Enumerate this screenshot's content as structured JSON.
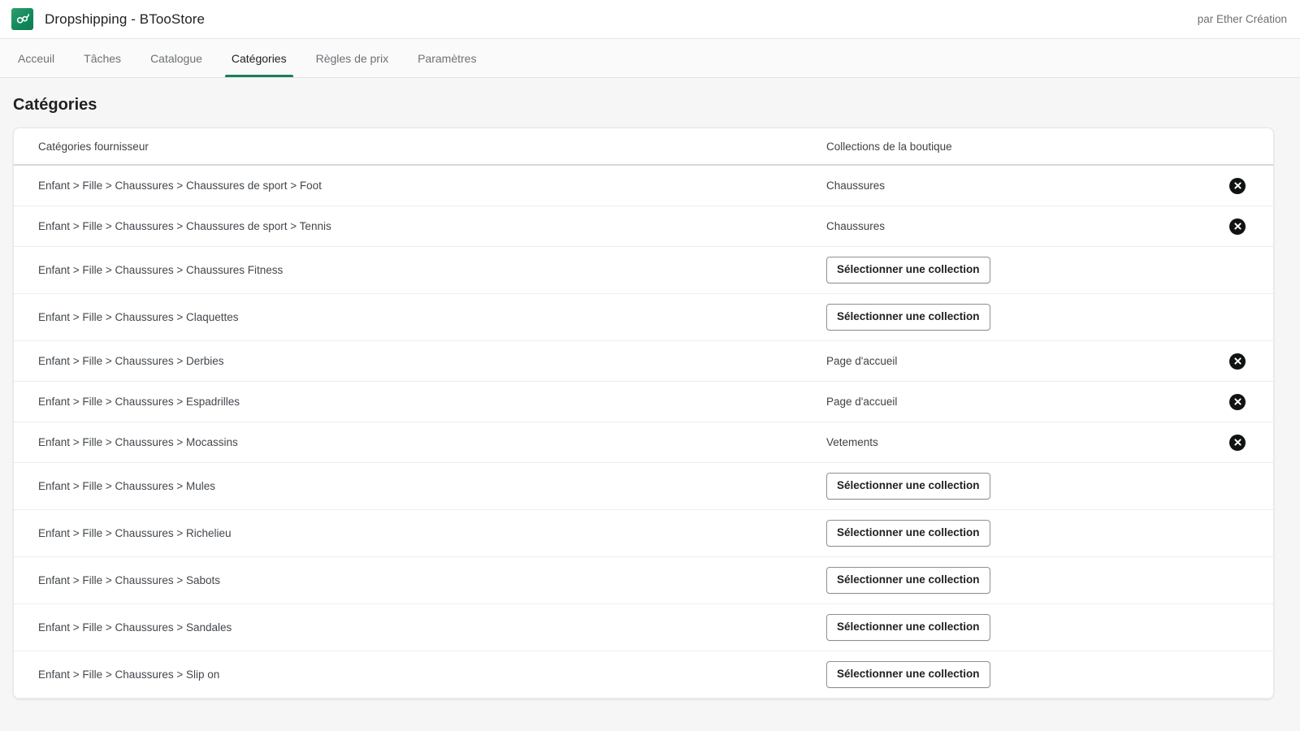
{
  "theme": {
    "accent": "#17805a",
    "logo_green": "#128a5d",
    "text_primary": "#202223",
    "text_secondary": "#6d7175",
    "page_bg": "#f6f6f7",
    "remove_btn_bg": "#111213"
  },
  "appbar": {
    "logo_icon": "infinity-chain-icon",
    "title": "Dropshipping - BTooStore",
    "author": "par Ether Création"
  },
  "nav": {
    "items": [
      {
        "label": "Acceuil",
        "active": false
      },
      {
        "label": "Tâches",
        "active": false
      },
      {
        "label": "Catalogue",
        "active": false
      },
      {
        "label": "Catégories",
        "active": true
      },
      {
        "label": "Règles de prix",
        "active": false
      },
      {
        "label": "Paramètres",
        "active": false
      }
    ]
  },
  "page": {
    "title": "Catégories"
  },
  "table": {
    "headers": {
      "supplier_categories": "Catégories fournisseur",
      "shop_collections": "Collections de la boutique"
    },
    "select_button_label": "Sélectionner une collection",
    "remove_icon": "close-circle-icon",
    "rows": [
      {
        "category": "Enfant > Fille > Chaussures > Chaussures de sport > Foot",
        "collection": "Chaussures",
        "has_collection": true
      },
      {
        "category": "Enfant > Fille > Chaussures > Chaussures de sport > Tennis",
        "collection": "Chaussures",
        "has_collection": true
      },
      {
        "category": "Enfant > Fille > Chaussures > Chaussures Fitness",
        "collection": null,
        "has_collection": false
      },
      {
        "category": "Enfant > Fille > Chaussures > Claquettes",
        "collection": null,
        "has_collection": false
      },
      {
        "category": "Enfant > Fille > Chaussures > Derbies",
        "collection": "Page d'accueil",
        "has_collection": true
      },
      {
        "category": "Enfant > Fille > Chaussures > Espadrilles",
        "collection": "Page d'accueil",
        "has_collection": true
      },
      {
        "category": "Enfant > Fille > Chaussures > Mocassins",
        "collection": "Vetements",
        "has_collection": true
      },
      {
        "category": "Enfant > Fille > Chaussures > Mules",
        "collection": null,
        "has_collection": false
      },
      {
        "category": "Enfant > Fille > Chaussures > Richelieu",
        "collection": null,
        "has_collection": false
      },
      {
        "category": "Enfant > Fille > Chaussures > Sabots",
        "collection": null,
        "has_collection": false
      },
      {
        "category": "Enfant > Fille > Chaussures > Sandales",
        "collection": null,
        "has_collection": false
      },
      {
        "category": "Enfant > Fille > Chaussures > Slip on",
        "collection": null,
        "has_collection": false
      }
    ]
  }
}
